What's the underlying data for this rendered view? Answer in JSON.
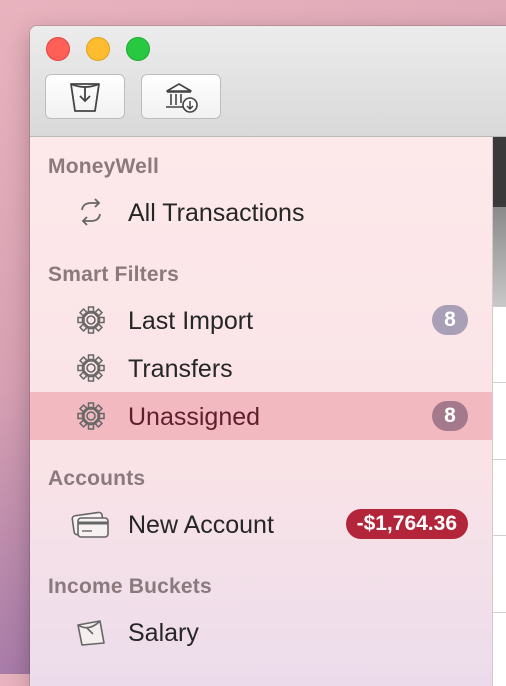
{
  "window": {
    "toolbar": {
      "buttons": [
        {
          "icon": "bucket-icon"
        },
        {
          "icon": "bank-download-icon"
        }
      ]
    }
  },
  "sidebar": {
    "sections": [
      {
        "title": "MoneyWell",
        "items": [
          {
            "label": "All Transactions",
            "icon": "refresh-arrows-icon"
          }
        ]
      },
      {
        "title": "Smart Filters",
        "items": [
          {
            "label": "Last Import",
            "icon": "gear-icon",
            "badge": "8"
          },
          {
            "label": "Transfers",
            "icon": "gear-icon"
          },
          {
            "label": "Unassigned",
            "icon": "gear-icon",
            "badge": "8",
            "selected": true
          }
        ]
      },
      {
        "title": "Accounts",
        "items": [
          {
            "label": "New Account",
            "icon": "credit-card-icon",
            "badge": "-$1,764.36"
          }
        ]
      },
      {
        "title": "Income Buckets",
        "items": [
          {
            "label": "Salary",
            "icon": "income-bucket-icon"
          }
        ]
      }
    ]
  },
  "colors": {
    "selection": "#f2b9c1",
    "negative_badge": "#b3253a",
    "count_badge": "#a99fb7"
  }
}
